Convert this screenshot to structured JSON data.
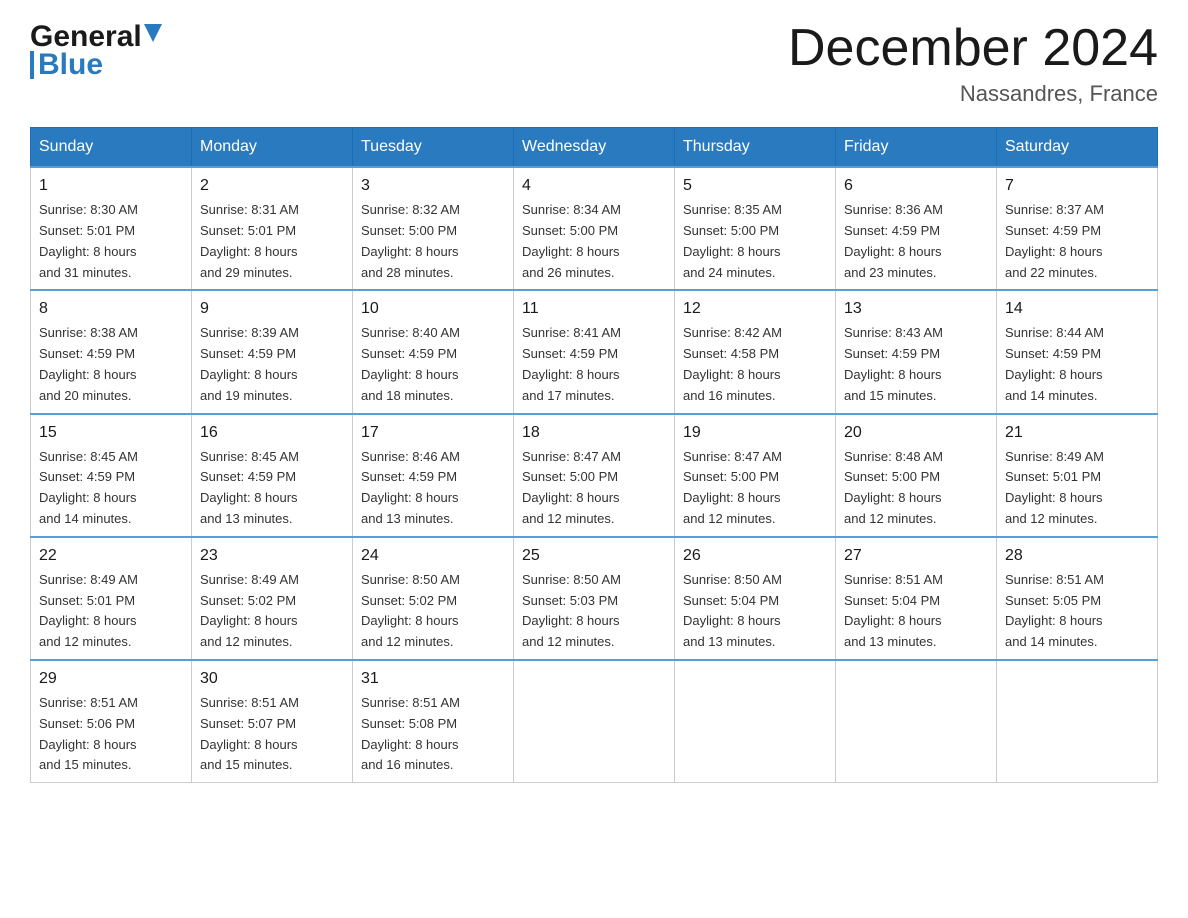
{
  "header": {
    "logo_general": "General",
    "logo_blue": "Blue",
    "month_title": "December 2024",
    "location": "Nassandres, France"
  },
  "days_of_week": [
    "Sunday",
    "Monday",
    "Tuesday",
    "Wednesday",
    "Thursday",
    "Friday",
    "Saturday"
  ],
  "weeks": [
    [
      {
        "day": "1",
        "sunrise": "8:30 AM",
        "sunset": "5:01 PM",
        "daylight": "8 hours and 31 minutes."
      },
      {
        "day": "2",
        "sunrise": "8:31 AM",
        "sunset": "5:01 PM",
        "daylight": "8 hours and 29 minutes."
      },
      {
        "day": "3",
        "sunrise": "8:32 AM",
        "sunset": "5:00 PM",
        "daylight": "8 hours and 28 minutes."
      },
      {
        "day": "4",
        "sunrise": "8:34 AM",
        "sunset": "5:00 PM",
        "daylight": "8 hours and 26 minutes."
      },
      {
        "day": "5",
        "sunrise": "8:35 AM",
        "sunset": "5:00 PM",
        "daylight": "8 hours and 24 minutes."
      },
      {
        "day": "6",
        "sunrise": "8:36 AM",
        "sunset": "4:59 PM",
        "daylight": "8 hours and 23 minutes."
      },
      {
        "day": "7",
        "sunrise": "8:37 AM",
        "sunset": "4:59 PM",
        "daylight": "8 hours and 22 minutes."
      }
    ],
    [
      {
        "day": "8",
        "sunrise": "8:38 AM",
        "sunset": "4:59 PM",
        "daylight": "8 hours and 20 minutes."
      },
      {
        "day": "9",
        "sunrise": "8:39 AM",
        "sunset": "4:59 PM",
        "daylight": "8 hours and 19 minutes."
      },
      {
        "day": "10",
        "sunrise": "8:40 AM",
        "sunset": "4:59 PM",
        "daylight": "8 hours and 18 minutes."
      },
      {
        "day": "11",
        "sunrise": "8:41 AM",
        "sunset": "4:59 PM",
        "daylight": "8 hours and 17 minutes."
      },
      {
        "day": "12",
        "sunrise": "8:42 AM",
        "sunset": "4:58 PM",
        "daylight": "8 hours and 16 minutes."
      },
      {
        "day": "13",
        "sunrise": "8:43 AM",
        "sunset": "4:59 PM",
        "daylight": "8 hours and 15 minutes."
      },
      {
        "day": "14",
        "sunrise": "8:44 AM",
        "sunset": "4:59 PM",
        "daylight": "8 hours and 14 minutes."
      }
    ],
    [
      {
        "day": "15",
        "sunrise": "8:45 AM",
        "sunset": "4:59 PM",
        "daylight": "8 hours and 14 minutes."
      },
      {
        "day": "16",
        "sunrise": "8:45 AM",
        "sunset": "4:59 PM",
        "daylight": "8 hours and 13 minutes."
      },
      {
        "day": "17",
        "sunrise": "8:46 AM",
        "sunset": "4:59 PM",
        "daylight": "8 hours and 13 minutes."
      },
      {
        "day": "18",
        "sunrise": "8:47 AM",
        "sunset": "5:00 PM",
        "daylight": "8 hours and 12 minutes."
      },
      {
        "day": "19",
        "sunrise": "8:47 AM",
        "sunset": "5:00 PM",
        "daylight": "8 hours and 12 minutes."
      },
      {
        "day": "20",
        "sunrise": "8:48 AM",
        "sunset": "5:00 PM",
        "daylight": "8 hours and 12 minutes."
      },
      {
        "day": "21",
        "sunrise": "8:49 AM",
        "sunset": "5:01 PM",
        "daylight": "8 hours and 12 minutes."
      }
    ],
    [
      {
        "day": "22",
        "sunrise": "8:49 AM",
        "sunset": "5:01 PM",
        "daylight": "8 hours and 12 minutes."
      },
      {
        "day": "23",
        "sunrise": "8:49 AM",
        "sunset": "5:02 PM",
        "daylight": "8 hours and 12 minutes."
      },
      {
        "day": "24",
        "sunrise": "8:50 AM",
        "sunset": "5:02 PM",
        "daylight": "8 hours and 12 minutes."
      },
      {
        "day": "25",
        "sunrise": "8:50 AM",
        "sunset": "5:03 PM",
        "daylight": "8 hours and 12 minutes."
      },
      {
        "day": "26",
        "sunrise": "8:50 AM",
        "sunset": "5:04 PM",
        "daylight": "8 hours and 13 minutes."
      },
      {
        "day": "27",
        "sunrise": "8:51 AM",
        "sunset": "5:04 PM",
        "daylight": "8 hours and 13 minutes."
      },
      {
        "day": "28",
        "sunrise": "8:51 AM",
        "sunset": "5:05 PM",
        "daylight": "8 hours and 14 minutes."
      }
    ],
    [
      {
        "day": "29",
        "sunrise": "8:51 AM",
        "sunset": "5:06 PM",
        "daylight": "8 hours and 15 minutes."
      },
      {
        "day": "30",
        "sunrise": "8:51 AM",
        "sunset": "5:07 PM",
        "daylight": "8 hours and 15 minutes."
      },
      {
        "day": "31",
        "sunrise": "8:51 AM",
        "sunset": "5:08 PM",
        "daylight": "8 hours and 16 minutes."
      },
      null,
      null,
      null,
      null
    ]
  ],
  "labels": {
    "sunrise": "Sunrise:",
    "sunset": "Sunset:",
    "daylight": "Daylight:"
  }
}
